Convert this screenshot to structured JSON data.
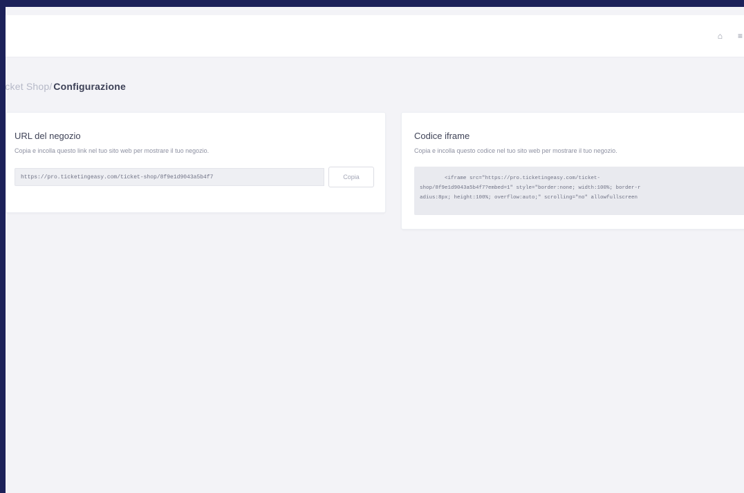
{
  "topbar": {
    "icons": [
      {
        "name": "bell-icon",
        "glyph": "⌂"
      },
      {
        "name": "menu-icon",
        "glyph": "≡"
      }
    ]
  },
  "breadcrumb": {
    "previous": "icket Shop",
    "separator": "/",
    "current": "Configurazione"
  },
  "url_card": {
    "title": "URL del negozio",
    "description": "Copia e incolla questo link nel tuo sito web per mostrare il tuo negozio.",
    "url_value": "https://pro.ticketingeasy.com/ticket-shop/8f9e1d9043a5b4f7",
    "copy_label": "Copia"
  },
  "iframe_card": {
    "title": "Codice iframe",
    "description": "Copia e incolla questo codice nel tuo sito web per mostrare il tuo negozio.",
    "code_line1": "        <iframe src=\"https://pro.ticketingeasy.com/ticket-",
    "code_line2": "shop/8f9e1d9043a5b4f7?embed=1\" style=\"border:none; width:100%; border-r",
    "code_line3": "adius:8px; height:100%; overflow:auto;\" scrolling=\"no\" allowfullscreen"
  }
}
